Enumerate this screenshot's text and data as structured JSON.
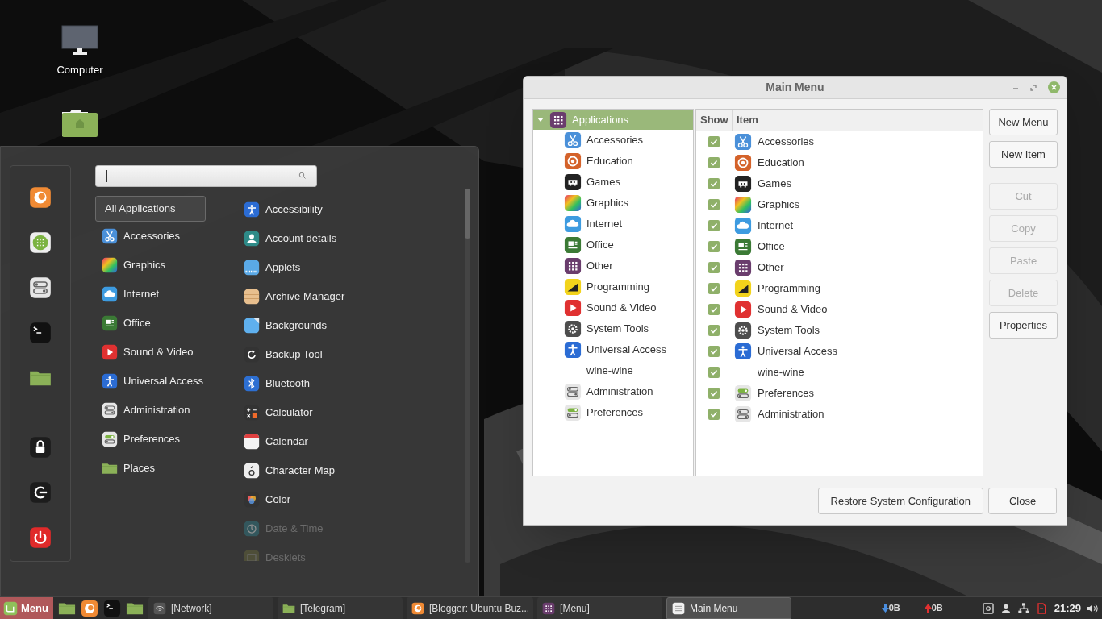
{
  "desktop_icons": [
    {
      "kind": "computer",
      "label": "Computer"
    },
    {
      "kind": "home"
    }
  ],
  "menu": {
    "favorites": [
      {
        "kind": "browser"
      },
      {
        "kind": "software"
      },
      {
        "kind": "settings"
      },
      {
        "kind": "terminal"
      },
      {
        "kind": "files"
      },
      {
        "kind": "separator"
      },
      {
        "kind": "lock"
      },
      {
        "kind": "logout"
      },
      {
        "kind": "power"
      }
    ],
    "categories": [
      {
        "label": "All Applications",
        "selected": true
      },
      {
        "label": "Accessories",
        "kind": "accessories",
        "selected": false
      },
      {
        "label": "Graphics",
        "kind": "graphics",
        "selected": false
      },
      {
        "label": "Internet",
        "kind": "internet",
        "selected": false
      },
      {
        "label": "Office",
        "kind": "office",
        "selected": false
      },
      {
        "label": "Sound & Video",
        "kind": "sound-video",
        "selected": false
      },
      {
        "label": "Universal Access",
        "kind": "universal-access",
        "selected": false
      },
      {
        "label": "Administration",
        "kind": "administration",
        "selected": false
      },
      {
        "label": "Preferences",
        "kind": "preferences",
        "selected": false
      },
      {
        "label": "Places",
        "kind": "places",
        "selected": false
      }
    ],
    "apps": [
      {
        "label": "Accessibility",
        "kind": "universal-access",
        "dimmed": false
      },
      {
        "label": "Account details",
        "kind": "account",
        "dimmed": false
      },
      {
        "label": "Applets",
        "kind": "applets",
        "dimmed": false
      },
      {
        "label": "Archive Manager",
        "kind": "archive",
        "dimmed": false
      },
      {
        "label": "Backgrounds",
        "kind": "backgrounds",
        "dimmed": false
      },
      {
        "label": "Backup Tool",
        "kind": "backup",
        "dimmed": false
      },
      {
        "label": "Bluetooth",
        "kind": "bluetooth",
        "dimmed": false
      },
      {
        "label": "Calculator",
        "kind": "calculator",
        "dimmed": false
      },
      {
        "label": "Calendar",
        "kind": "calendar",
        "dimmed": false
      },
      {
        "label": "Character Map",
        "kind": "charmap",
        "dimmed": false
      },
      {
        "label": "Color",
        "kind": "color",
        "dimmed": false
      },
      {
        "label": "Date & Time",
        "kind": "datetime",
        "dimmed": true
      },
      {
        "label": "Desklets",
        "kind": "desklets",
        "dimmed": true
      }
    ]
  },
  "window": {
    "title": "Main Menu",
    "tree": [
      {
        "label": "Applications",
        "kind": "other",
        "expanded": true,
        "selected": true,
        "children": [
          {
            "label": "Accessories",
            "kind": "accessories"
          },
          {
            "label": "Education",
            "kind": "education"
          },
          {
            "label": "Games",
            "kind": "games"
          },
          {
            "label": "Graphics",
            "kind": "graphics"
          },
          {
            "label": "Internet",
            "kind": "internet"
          },
          {
            "label": "Office",
            "kind": "office"
          },
          {
            "label": "Other",
            "kind": "other"
          },
          {
            "label": "Programming",
            "kind": "programming"
          },
          {
            "label": "Sound & Video",
            "kind": "sound-video"
          },
          {
            "label": "System Tools",
            "kind": "system"
          },
          {
            "label": "Universal Access",
            "kind": "universal-access"
          },
          {
            "label": "wine-wine"
          },
          {
            "label": "Administration",
            "kind": "administration"
          },
          {
            "label": "Preferences",
            "kind": "preferences"
          }
        ]
      }
    ],
    "table": {
      "columns": [
        "Show",
        "Item"
      ],
      "rows": [
        {
          "show": true,
          "label": "Accessories",
          "kind": "accessories"
        },
        {
          "show": true,
          "label": "Education",
          "kind": "education"
        },
        {
          "show": true,
          "label": "Games",
          "kind": "games"
        },
        {
          "show": true,
          "label": "Graphics",
          "kind": "graphics"
        },
        {
          "show": true,
          "label": "Internet",
          "kind": "internet"
        },
        {
          "show": true,
          "label": "Office",
          "kind": "office"
        },
        {
          "show": true,
          "label": "Other",
          "kind": "other"
        },
        {
          "show": true,
          "label": "Programming",
          "kind": "programming"
        },
        {
          "show": true,
          "label": "Sound & Video",
          "kind": "sound-video"
        },
        {
          "show": true,
          "label": "System Tools",
          "kind": "system"
        },
        {
          "show": true,
          "label": "Universal Access",
          "kind": "universal-access"
        },
        {
          "show": true,
          "label": "wine-wine"
        },
        {
          "show": true,
          "label": "Preferences",
          "kind": "preferences"
        },
        {
          "show": true,
          "label": "Administration",
          "kind": "administration"
        }
      ]
    },
    "button_groups": [
      [
        {
          "label": "New Menu",
          "disabled": false
        },
        {
          "label": "New Item",
          "disabled": false
        }
      ],
      [
        {
          "label": "Cut",
          "disabled": true
        },
        {
          "label": "Copy",
          "disabled": true
        },
        {
          "label": "Paste",
          "disabled": true
        },
        {
          "label": "Delete",
          "disabled": true
        },
        {
          "label": "Properties",
          "disabled": false
        }
      ]
    ],
    "footer_buttons": [
      "Restore System Configuration",
      "Close"
    ]
  },
  "taskbar": {
    "menu_button": "Menu",
    "launchers": [
      {
        "kind": "files"
      },
      {
        "kind": "browser"
      },
      {
        "kind": "terminal"
      },
      {
        "kind": "places"
      }
    ],
    "windows": [
      {
        "label": "[Network]",
        "kind": "wifi",
        "selected": false
      },
      {
        "label": "[Telegram]",
        "kind": "places",
        "selected": false
      },
      {
        "label": "[Blogger: Ubuntu Buz...",
        "kind": "browser",
        "selected": false
      },
      {
        "label": "[Menu]",
        "kind": "other",
        "selected": false
      },
      {
        "label": "Main Menu",
        "kind": "list",
        "selected": true
      }
    ],
    "net_down": "0B",
    "net_up": "0B",
    "tray": [
      {
        "kind": "keyboard"
      },
      {
        "kind": "user"
      },
      {
        "kind": "network"
      },
      {
        "kind": "battery"
      }
    ],
    "clock": "21:29",
    "tray_end": [
      {
        "kind": "volume"
      }
    ]
  }
}
